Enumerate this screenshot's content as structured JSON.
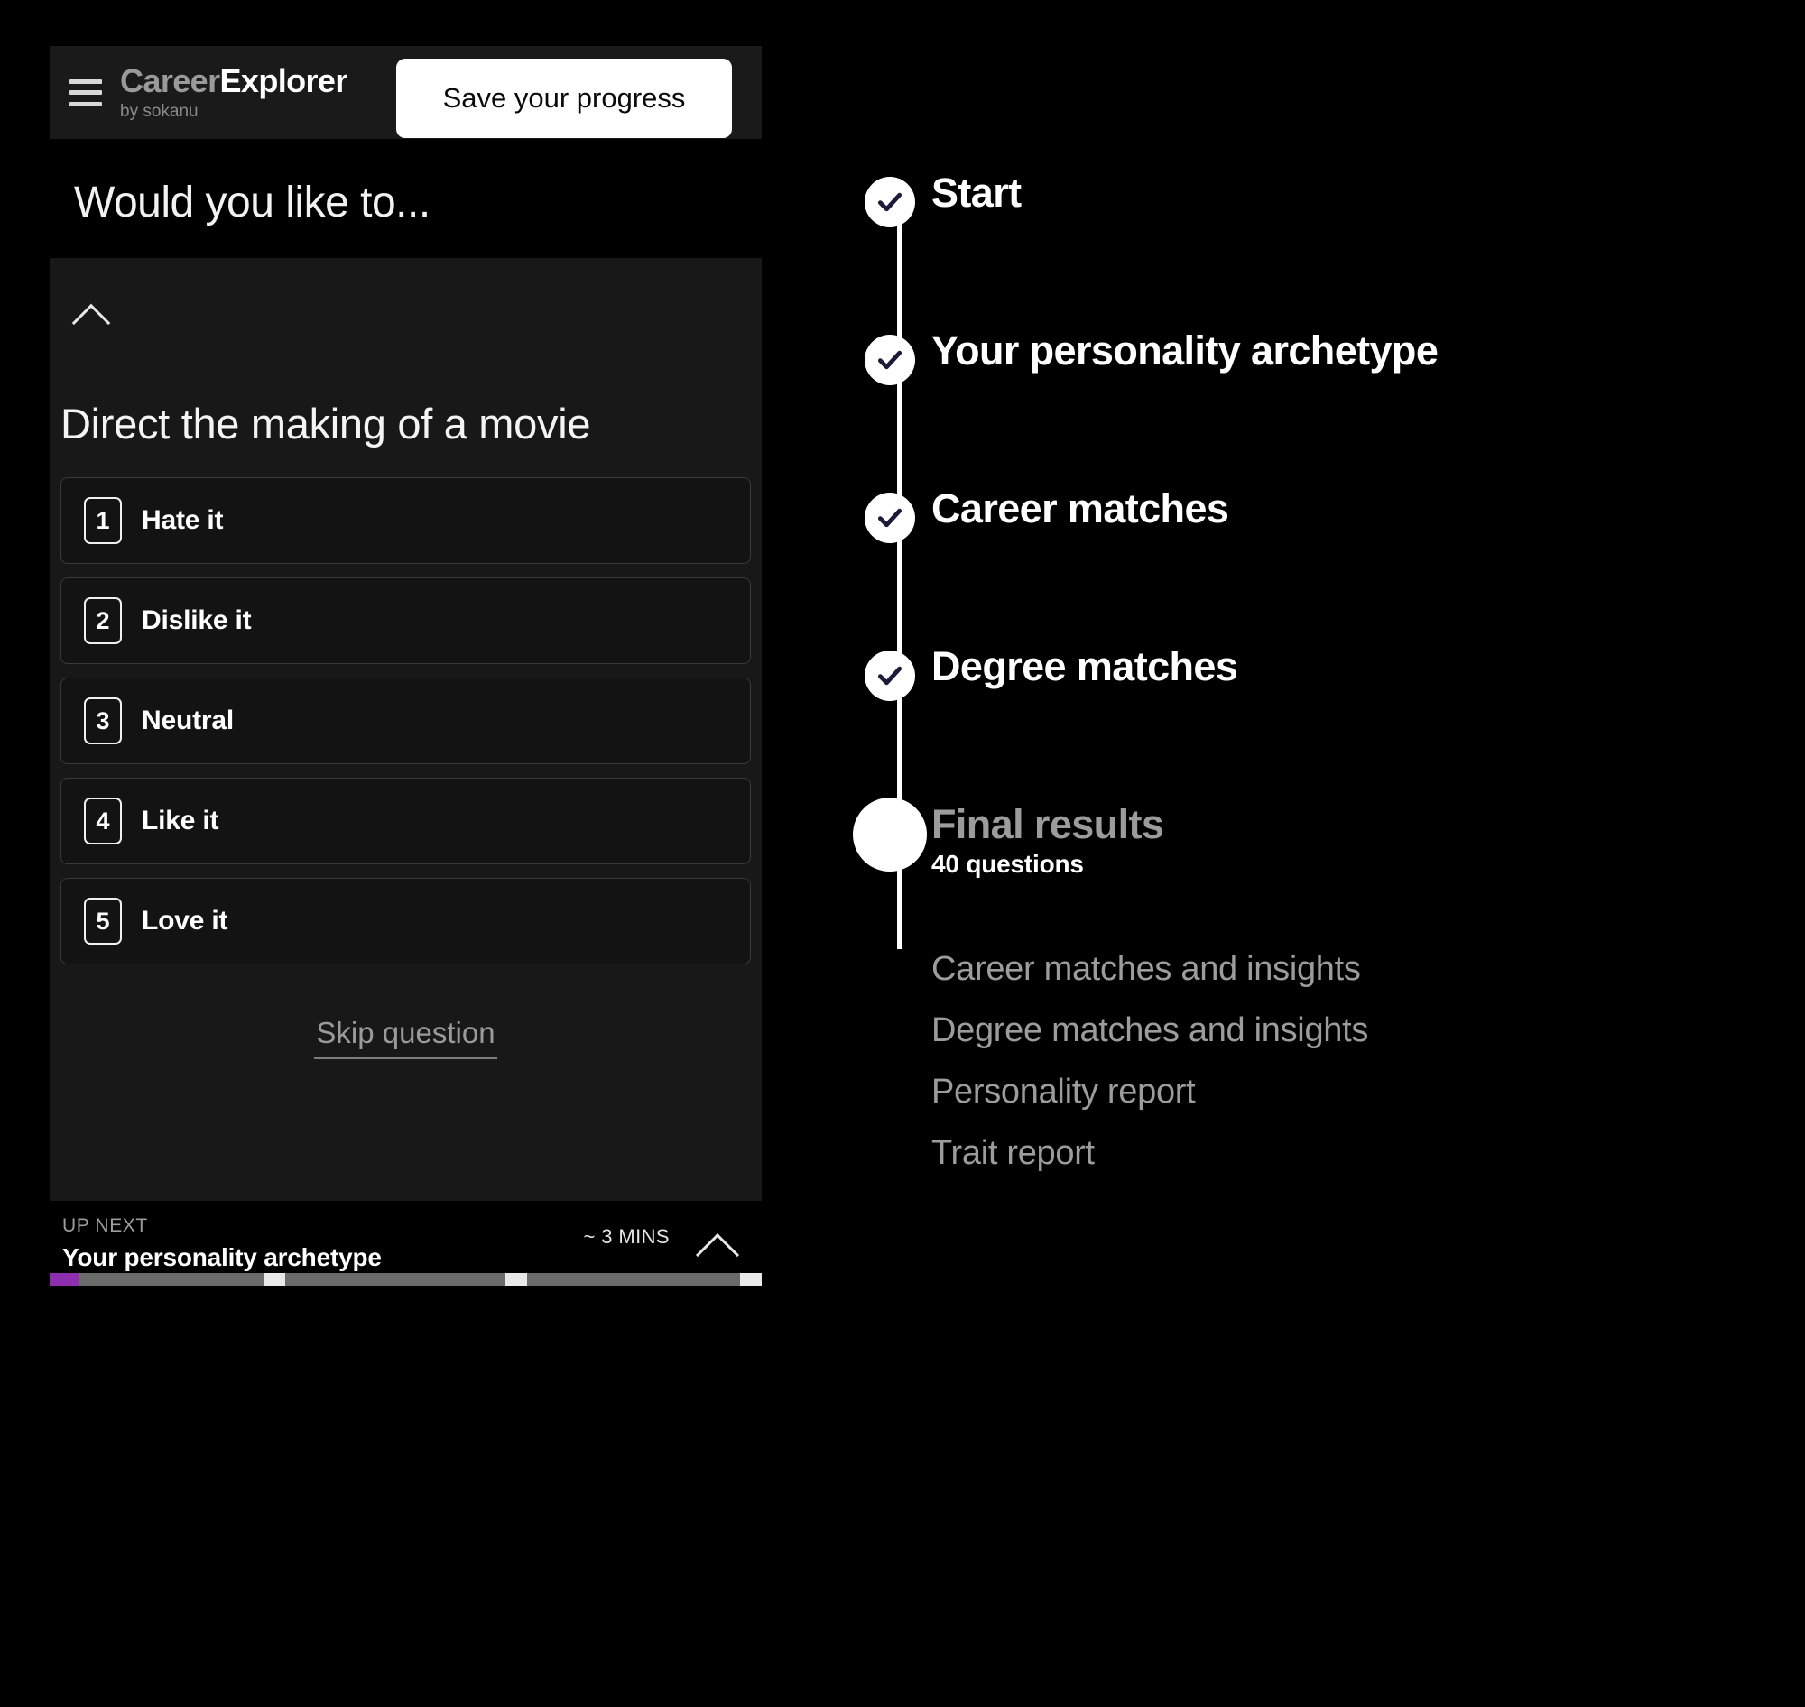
{
  "header": {
    "menu_icon": "hamburger-icon",
    "brand_primary": "Career",
    "brand_secondary": "Explorer",
    "brand_tagline": "by sokanu",
    "save_label": "Save your progress"
  },
  "page": {
    "title": "Would you like to..."
  },
  "question": {
    "collapse_icon": "chevron-up-icon",
    "text": "Direct the making of a movie",
    "options": [
      {
        "number": "1",
        "label": "Hate it"
      },
      {
        "number": "2",
        "label": "Dislike it"
      },
      {
        "number": "3",
        "label": "Neutral"
      },
      {
        "number": "4",
        "label": "Like it"
      },
      {
        "number": "5",
        "label": "Love it"
      }
    ],
    "skip_label": "Skip question"
  },
  "up_next": {
    "kicker": "UP NEXT",
    "title": "Your personality archetype",
    "time_estimate": "~ 3 MINS",
    "expand_icon": "chevron-up-icon"
  },
  "progress": {
    "percent": 4,
    "fill_color": "#8e2fb0",
    "track_color": "#6b6b6b",
    "marker_color": "#e9e9e9",
    "markers_percent": [
      30,
      64,
      97
    ]
  },
  "timeline": {
    "steps": [
      {
        "label": "Start",
        "state": "complete",
        "icon": "check-icon"
      },
      {
        "label": "Your personality archetype",
        "state": "complete",
        "icon": "check-icon"
      },
      {
        "label": "Career matches",
        "state": "complete",
        "icon": "check-icon"
      },
      {
        "label": "Degree matches",
        "state": "complete",
        "icon": "check-icon"
      },
      {
        "label": "Final results",
        "state": "current",
        "sub": "40 questions"
      }
    ],
    "deliverables": [
      "Career matches and insights",
      "Degree matches and insights",
      "Personality report",
      "Trait report"
    ]
  }
}
